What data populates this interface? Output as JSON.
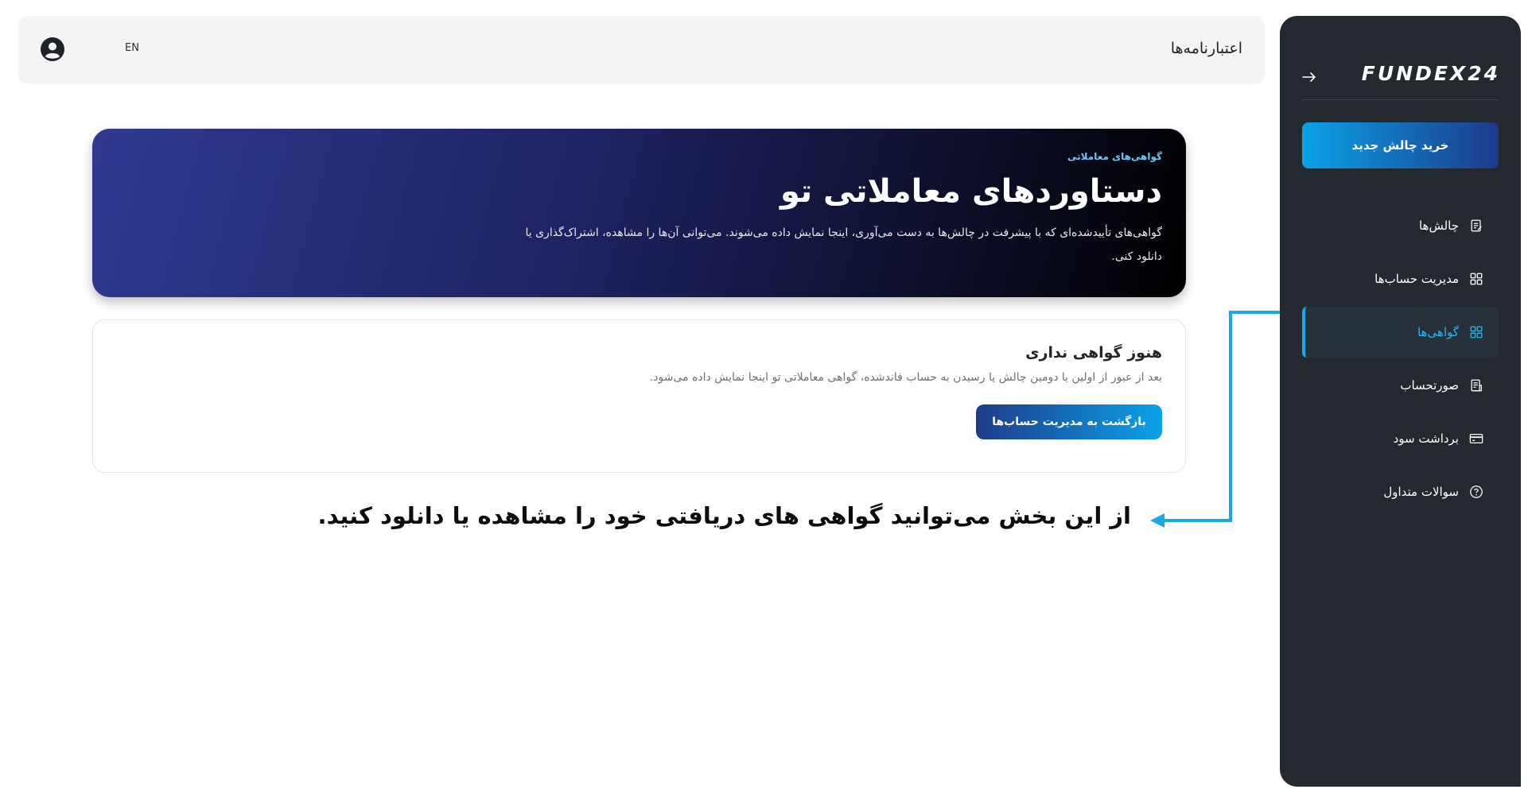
{
  "sidebar": {
    "brand": "FUNDEX24",
    "cta_label": "خرید چالش جدید",
    "items": [
      {
        "label": "چالش‌ها",
        "icon": "document-icon",
        "active": false
      },
      {
        "label": "مدیریت حساب‌ها",
        "icon": "grid-icon",
        "active": false
      },
      {
        "label": "گواهی‌ها",
        "icon": "grid-icon",
        "active": true
      },
      {
        "label": "صورتحساب",
        "icon": "invoice-icon",
        "active": false
      },
      {
        "label": "برداشت سود",
        "icon": "card-icon",
        "active": false
      },
      {
        "label": "سوالات متداول",
        "icon": "help-circle-icon",
        "active": false
      }
    ]
  },
  "header": {
    "title": "اعتبارنامه‌ها",
    "lang": "EN"
  },
  "hero": {
    "kicker": "گواهی‌های معاملاتی",
    "title": "دستاوردهای معاملاتی تو",
    "description": "گواهی‌های تأییدشده‌ای که با پیشرفت در چالش‌ها به دست می‌آوری، اینجا نمایش داده می‌شوند. می‌توانی آن‌ها را مشاهده، اشتراک‌گذاری یا دانلود کنی."
  },
  "empty_state": {
    "title": "هنوز گواهی نداری",
    "description": "بعد از عبور از اولین یا دومین چالش یا رسیدن به حساب فاندشده، گواهی معاملاتی تو اینجا نمایش داده می‌شود.",
    "button_label": "بازگشت به مدیریت حساب‌ها"
  },
  "annotation": {
    "text": "از این بخش می‌توانید گواهی های دریافتی خود را مشاهده یا دانلود کنید."
  },
  "colors": {
    "sidebar_bg": "#24282f",
    "accent": "#13a9ec",
    "hero_start": "#2f3a8f",
    "hero_end": "#000000"
  }
}
